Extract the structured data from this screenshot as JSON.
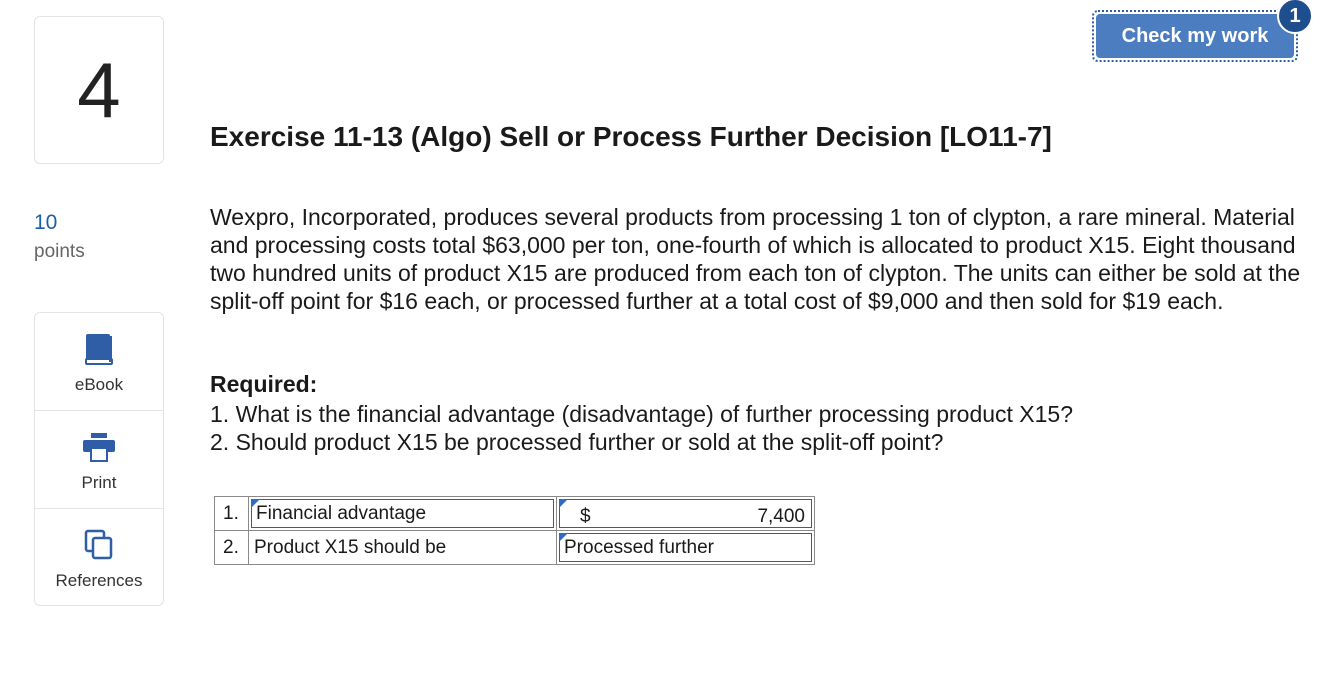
{
  "question": {
    "number": "4",
    "points_value": "10",
    "points_label": "points"
  },
  "tools": {
    "ebook_label": "eBook",
    "print_label": "Print",
    "references_label": "References"
  },
  "header": {
    "check_button_label": "Check my work",
    "check_badge": "1"
  },
  "exercise": {
    "title": "Exercise 11-13 (Algo) Sell or Process Further Decision [LO11-7]",
    "problem_text": "Wexpro, Incorporated, produces several products from processing 1 ton of clypton, a rare mineral. Material and processing costs total $63,000 per ton, one-fourth of which is allocated to product X15. Eight thousand two hundred units of product X15 are produced from each ton of clypton. The units can either be sold at the split-off point for $16 each, or processed further at a total cost of $9,000 and then sold for $19 each.",
    "required_heading": "Required:",
    "required_items": [
      "1. What is the financial advantage (disadvantage) of further processing product X15?",
      "2. Should product X15 be processed further or sold at the split-off point?"
    ]
  },
  "answers": [
    {
      "num": "1.",
      "label": "Financial advantage",
      "currency": "$",
      "value": "7,400"
    },
    {
      "num": "2.",
      "label": "Product X15 should be",
      "value": "Processed further"
    }
  ],
  "colors": {
    "accent": "#4b7dc0",
    "badge": "#1f4e8f",
    "link": "#1d5ea8",
    "field_border": "#2f5ea6"
  }
}
